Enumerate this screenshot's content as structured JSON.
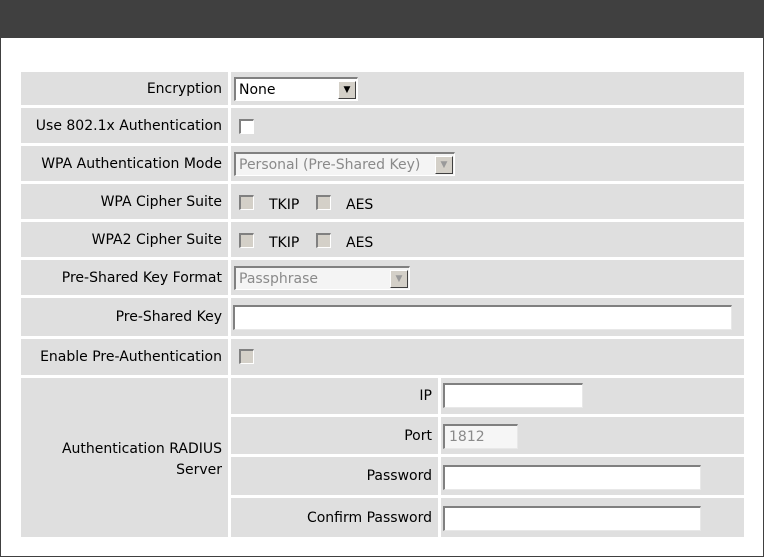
{
  "form": {
    "encryption": {
      "label": "Encryption",
      "value": "None"
    },
    "use_8021x": {
      "label": "Use 802.1x Authentication"
    },
    "wpa_auth_mode": {
      "label": "WPA Authentication Mode",
      "value": "Personal (Pre-Shared Key)"
    },
    "wpa_cipher": {
      "label": "WPA Cipher Suite",
      "opt1": "TKIP",
      "opt2": "AES"
    },
    "wpa2_cipher": {
      "label": "WPA2 Cipher Suite",
      "opt1": "TKIP",
      "opt2": "AES"
    },
    "psk_format": {
      "label": "Pre-Shared Key Format",
      "value": "Passphrase"
    },
    "psk": {
      "label": "Pre-Shared Key",
      "value": ""
    },
    "pre_auth": {
      "label": "Enable Pre-Authentication"
    },
    "radius": {
      "label_line1": "Authentication RADIUS",
      "label_line2": "Server",
      "ip": {
        "label": "IP",
        "value": ""
      },
      "port": {
        "label": "Port",
        "value": "1812"
      },
      "password": {
        "label": "Password",
        "value": ""
      },
      "confirm_password": {
        "label": "Confirm Password",
        "value": ""
      }
    }
  },
  "icons": {
    "dropdown": "chevron-down-icon"
  },
  "colors": {
    "header_bar": "#404040",
    "cell_bg": "#dfdfdf"
  }
}
